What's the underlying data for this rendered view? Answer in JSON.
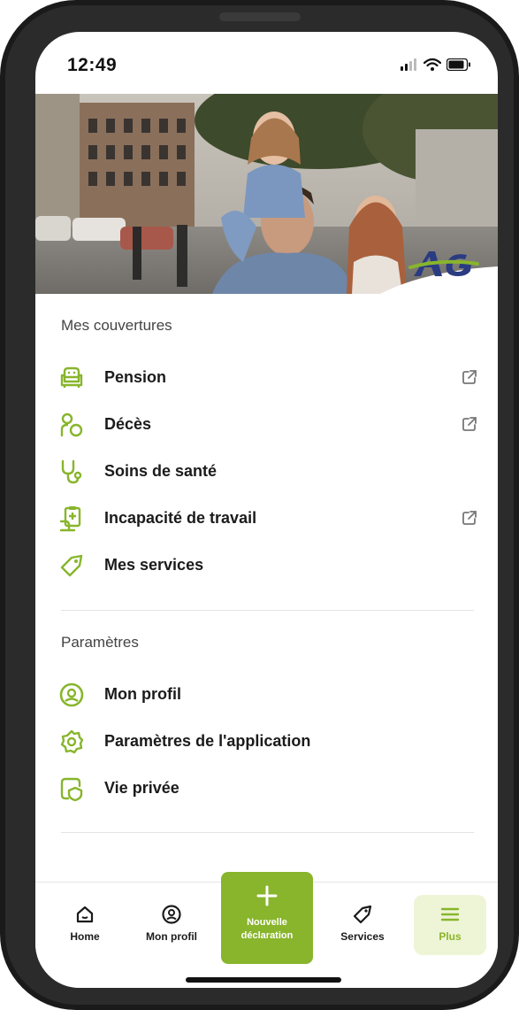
{
  "status_bar": {
    "time": "12:49"
  },
  "brand": {
    "logo_text": "AG",
    "logo_color": "#2a3b82",
    "accent": "#88b52c"
  },
  "coverages": {
    "title": "Mes couvertures",
    "items": [
      {
        "label": "Pension",
        "icon": "armchair-icon",
        "external": true
      },
      {
        "label": "Décès",
        "icon": "person-circle-icon",
        "external": true
      },
      {
        "label": "Soins de santé",
        "icon": "stethoscope-icon",
        "external": false
      },
      {
        "label": "Incapacité de travail",
        "icon": "work-incapacity-icon",
        "external": true
      },
      {
        "label": "Mes services",
        "icon": "tag-icon",
        "external": false
      }
    ]
  },
  "settings": {
    "title": "Paramètres",
    "items": [
      {
        "label": "Mon profil",
        "icon": "profile-icon"
      },
      {
        "label": "Paramètres de l'application",
        "icon": "gear-icon"
      },
      {
        "label": "Vie privée",
        "icon": "privacy-icon"
      }
    ]
  },
  "tabbar": {
    "home": "Home",
    "profile": "Mon profil",
    "new_claim_line1": "Nouvelle",
    "new_claim_line2": "déclaration",
    "services": "Services",
    "more": "Plus"
  }
}
